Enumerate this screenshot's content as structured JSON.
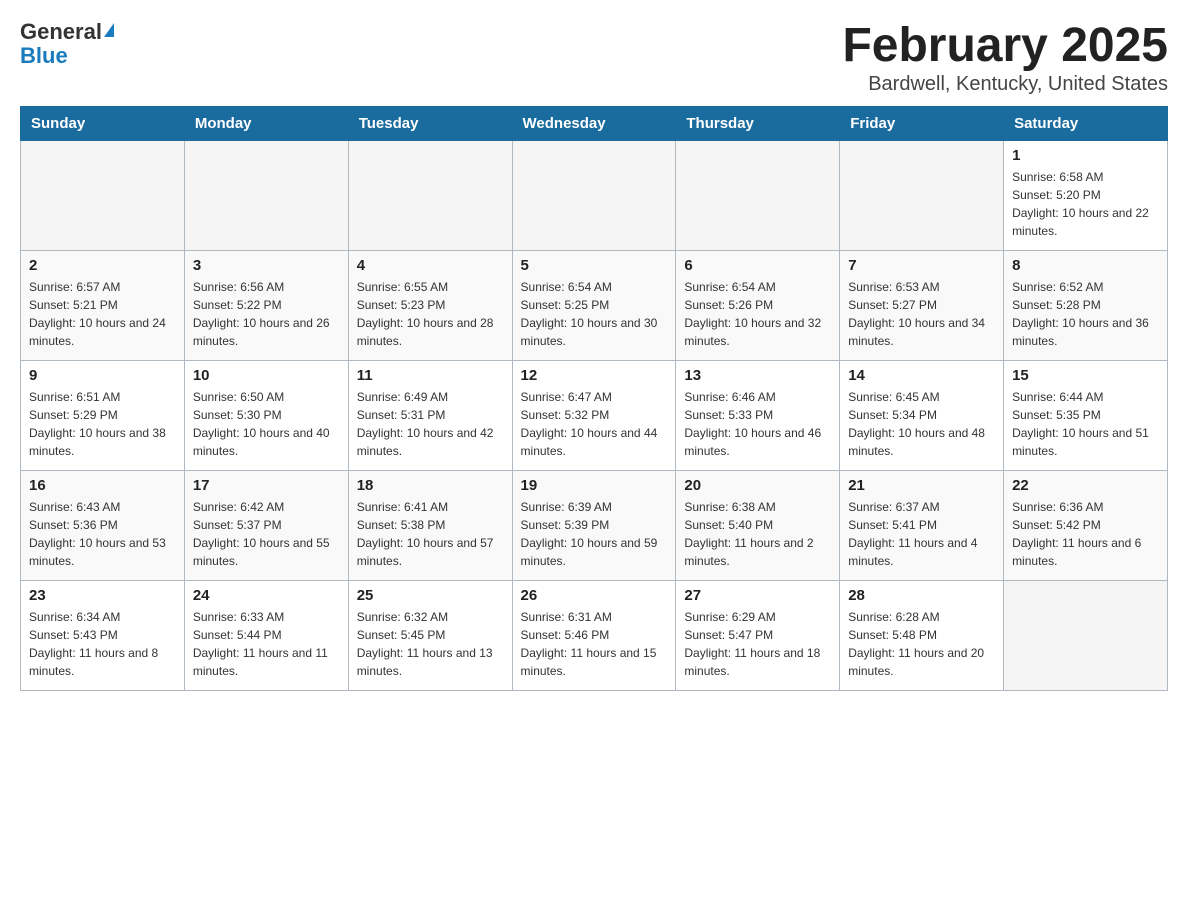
{
  "header": {
    "logo_general": "General",
    "logo_blue": "Blue",
    "month_title": "February 2025",
    "location": "Bardwell, Kentucky, United States"
  },
  "days_of_week": [
    "Sunday",
    "Monday",
    "Tuesday",
    "Wednesday",
    "Thursday",
    "Friday",
    "Saturday"
  ],
  "weeks": [
    [
      {
        "day": "",
        "sunrise": "",
        "sunset": "",
        "daylight": ""
      },
      {
        "day": "",
        "sunrise": "",
        "sunset": "",
        "daylight": ""
      },
      {
        "day": "",
        "sunrise": "",
        "sunset": "",
        "daylight": ""
      },
      {
        "day": "",
        "sunrise": "",
        "sunset": "",
        "daylight": ""
      },
      {
        "day": "",
        "sunrise": "",
        "sunset": "",
        "daylight": ""
      },
      {
        "day": "",
        "sunrise": "",
        "sunset": "",
        "daylight": ""
      },
      {
        "day": "1",
        "sunrise": "Sunrise: 6:58 AM",
        "sunset": "Sunset: 5:20 PM",
        "daylight": "Daylight: 10 hours and 22 minutes."
      }
    ],
    [
      {
        "day": "2",
        "sunrise": "Sunrise: 6:57 AM",
        "sunset": "Sunset: 5:21 PM",
        "daylight": "Daylight: 10 hours and 24 minutes."
      },
      {
        "day": "3",
        "sunrise": "Sunrise: 6:56 AM",
        "sunset": "Sunset: 5:22 PM",
        "daylight": "Daylight: 10 hours and 26 minutes."
      },
      {
        "day": "4",
        "sunrise": "Sunrise: 6:55 AM",
        "sunset": "Sunset: 5:23 PM",
        "daylight": "Daylight: 10 hours and 28 minutes."
      },
      {
        "day": "5",
        "sunrise": "Sunrise: 6:54 AM",
        "sunset": "Sunset: 5:25 PM",
        "daylight": "Daylight: 10 hours and 30 minutes."
      },
      {
        "day": "6",
        "sunrise": "Sunrise: 6:54 AM",
        "sunset": "Sunset: 5:26 PM",
        "daylight": "Daylight: 10 hours and 32 minutes."
      },
      {
        "day": "7",
        "sunrise": "Sunrise: 6:53 AM",
        "sunset": "Sunset: 5:27 PM",
        "daylight": "Daylight: 10 hours and 34 minutes."
      },
      {
        "day": "8",
        "sunrise": "Sunrise: 6:52 AM",
        "sunset": "Sunset: 5:28 PM",
        "daylight": "Daylight: 10 hours and 36 minutes."
      }
    ],
    [
      {
        "day": "9",
        "sunrise": "Sunrise: 6:51 AM",
        "sunset": "Sunset: 5:29 PM",
        "daylight": "Daylight: 10 hours and 38 minutes."
      },
      {
        "day": "10",
        "sunrise": "Sunrise: 6:50 AM",
        "sunset": "Sunset: 5:30 PM",
        "daylight": "Daylight: 10 hours and 40 minutes."
      },
      {
        "day": "11",
        "sunrise": "Sunrise: 6:49 AM",
        "sunset": "Sunset: 5:31 PM",
        "daylight": "Daylight: 10 hours and 42 minutes."
      },
      {
        "day": "12",
        "sunrise": "Sunrise: 6:47 AM",
        "sunset": "Sunset: 5:32 PM",
        "daylight": "Daylight: 10 hours and 44 minutes."
      },
      {
        "day": "13",
        "sunrise": "Sunrise: 6:46 AM",
        "sunset": "Sunset: 5:33 PM",
        "daylight": "Daylight: 10 hours and 46 minutes."
      },
      {
        "day": "14",
        "sunrise": "Sunrise: 6:45 AM",
        "sunset": "Sunset: 5:34 PM",
        "daylight": "Daylight: 10 hours and 48 minutes."
      },
      {
        "day": "15",
        "sunrise": "Sunrise: 6:44 AM",
        "sunset": "Sunset: 5:35 PM",
        "daylight": "Daylight: 10 hours and 51 minutes."
      }
    ],
    [
      {
        "day": "16",
        "sunrise": "Sunrise: 6:43 AM",
        "sunset": "Sunset: 5:36 PM",
        "daylight": "Daylight: 10 hours and 53 minutes."
      },
      {
        "day": "17",
        "sunrise": "Sunrise: 6:42 AM",
        "sunset": "Sunset: 5:37 PM",
        "daylight": "Daylight: 10 hours and 55 minutes."
      },
      {
        "day": "18",
        "sunrise": "Sunrise: 6:41 AM",
        "sunset": "Sunset: 5:38 PM",
        "daylight": "Daylight: 10 hours and 57 minutes."
      },
      {
        "day": "19",
        "sunrise": "Sunrise: 6:39 AM",
        "sunset": "Sunset: 5:39 PM",
        "daylight": "Daylight: 10 hours and 59 minutes."
      },
      {
        "day": "20",
        "sunrise": "Sunrise: 6:38 AM",
        "sunset": "Sunset: 5:40 PM",
        "daylight": "Daylight: 11 hours and 2 minutes."
      },
      {
        "day": "21",
        "sunrise": "Sunrise: 6:37 AM",
        "sunset": "Sunset: 5:41 PM",
        "daylight": "Daylight: 11 hours and 4 minutes."
      },
      {
        "day": "22",
        "sunrise": "Sunrise: 6:36 AM",
        "sunset": "Sunset: 5:42 PM",
        "daylight": "Daylight: 11 hours and 6 minutes."
      }
    ],
    [
      {
        "day": "23",
        "sunrise": "Sunrise: 6:34 AM",
        "sunset": "Sunset: 5:43 PM",
        "daylight": "Daylight: 11 hours and 8 minutes."
      },
      {
        "day": "24",
        "sunrise": "Sunrise: 6:33 AM",
        "sunset": "Sunset: 5:44 PM",
        "daylight": "Daylight: 11 hours and 11 minutes."
      },
      {
        "day": "25",
        "sunrise": "Sunrise: 6:32 AM",
        "sunset": "Sunset: 5:45 PM",
        "daylight": "Daylight: 11 hours and 13 minutes."
      },
      {
        "day": "26",
        "sunrise": "Sunrise: 6:31 AM",
        "sunset": "Sunset: 5:46 PM",
        "daylight": "Daylight: 11 hours and 15 minutes."
      },
      {
        "day": "27",
        "sunrise": "Sunrise: 6:29 AM",
        "sunset": "Sunset: 5:47 PM",
        "daylight": "Daylight: 11 hours and 18 minutes."
      },
      {
        "day": "28",
        "sunrise": "Sunrise: 6:28 AM",
        "sunset": "Sunset: 5:48 PM",
        "daylight": "Daylight: 11 hours and 20 minutes."
      },
      {
        "day": "",
        "sunrise": "",
        "sunset": "",
        "daylight": ""
      }
    ]
  ]
}
